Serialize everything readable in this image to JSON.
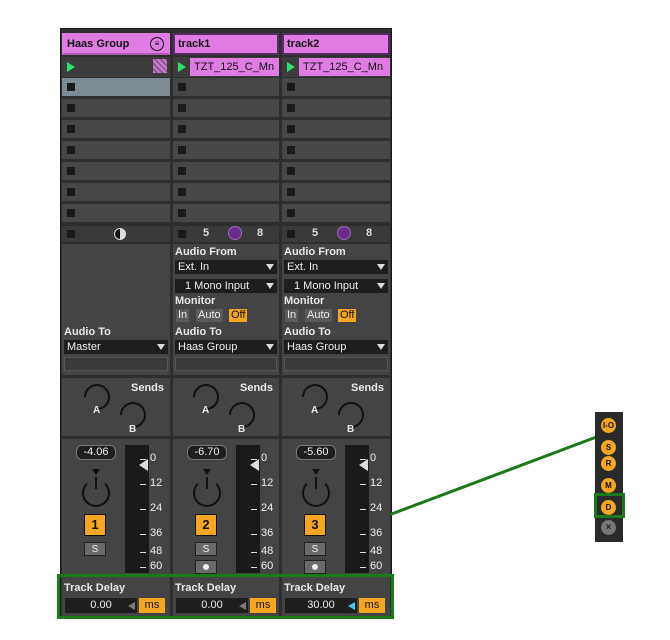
{
  "tracks": [
    {
      "name": "Haas Group",
      "type": "group",
      "launch_clip": "",
      "send_a": "",
      "send_b": "",
      "audio_to_label": "Audio To",
      "audio_to": "Master",
      "volume": "-4.06",
      "number": "1",
      "solo": "S",
      "track_delay_label": "Track Delay",
      "track_delay": "0.00",
      "track_delay_unit": "ms"
    },
    {
      "name": "track1",
      "type": "audio",
      "launch_clip": "TZT_125_C_Mn",
      "send_a": "5",
      "send_b": "8",
      "audio_from_label": "Audio From",
      "audio_from": "Ext. In",
      "audio_from_channel": "1 Mono Input",
      "monitor_label": "Monitor",
      "monitor_options": [
        "In",
        "Auto",
        "Off"
      ],
      "monitor_selected": "Off",
      "audio_to_label": "Audio To",
      "audio_to": "Haas Group",
      "volume": "-6.70",
      "number": "2",
      "solo": "S",
      "track_delay_label": "Track Delay",
      "track_delay": "0.00",
      "track_delay_unit": "ms"
    },
    {
      "name": "track2",
      "type": "audio",
      "launch_clip": "TZT_125_C_Mn",
      "send_a": "5",
      "send_b": "8",
      "audio_from_label": "Audio From",
      "audio_from": "Ext. In",
      "audio_from_channel": "1 Mono Input",
      "monitor_label": "Monitor",
      "monitor_options": [
        "In",
        "Auto",
        "Off"
      ],
      "monitor_selected": "Off",
      "audio_to_label": "Audio To",
      "audio_to": "Haas Group",
      "volume": "-5.60",
      "number": "3",
      "solo": "S",
      "track_delay_label": "Track Delay",
      "track_delay": "30.00",
      "track_delay_unit": "ms"
    }
  ],
  "sends_label": "Sends",
  "send_letters": [
    "A",
    "B"
  ],
  "meter_scale": [
    "0",
    "12",
    "24",
    "36",
    "48",
    "60"
  ],
  "side_panel": {
    "buttons": [
      "I-O",
      "S",
      "R",
      "M",
      "D",
      "×"
    ]
  },
  "colors": {
    "track_color": "#e07be3",
    "accent_orange": "#f5a623",
    "highlight_green": "#1a7a1a",
    "play_green": "#2ee06a"
  }
}
